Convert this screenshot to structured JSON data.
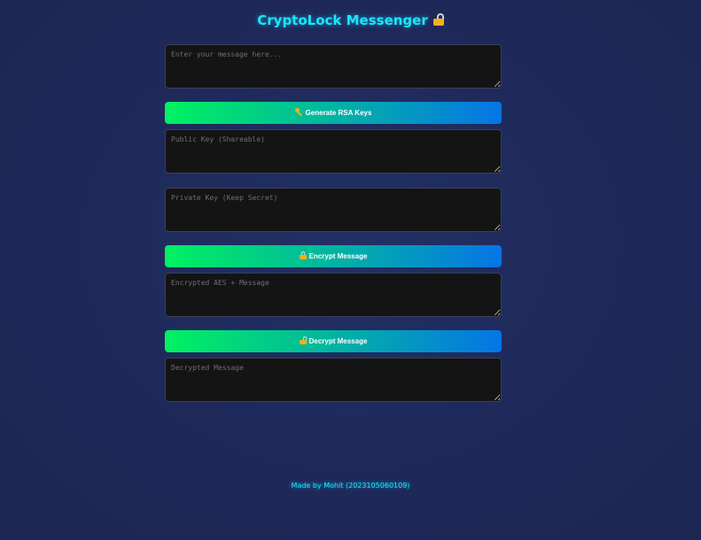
{
  "app": {
    "title": "CryptoLock Messenger",
    "title_icon": "lock-icon",
    "accent_color": "#19e6ff",
    "button_gradient": [
      "#00f260",
      "#0575e6"
    ],
    "background_color": "#1f2a5c"
  },
  "message": {
    "value": "",
    "placeholder": "Enter your message here..."
  },
  "generate": {
    "icon": "key-icon",
    "label": "Generate RSA Keys"
  },
  "public_key": {
    "value": "",
    "placeholder": "Public Key (Shareable)"
  },
  "private_key": {
    "value": "",
    "placeholder": "Private Key (Keep Secret)"
  },
  "encrypt": {
    "icon": "lock-icon",
    "label": "Encrypt Message"
  },
  "encrypted": {
    "value": "",
    "placeholder": "Encrypted AES + Message"
  },
  "decrypt": {
    "icon": "unlock-icon",
    "label": "Decrypt Message"
  },
  "decrypted": {
    "value": "",
    "placeholder": "Decrypted Message"
  },
  "footer": {
    "text": "Made by Mohit (2023105060109)"
  }
}
